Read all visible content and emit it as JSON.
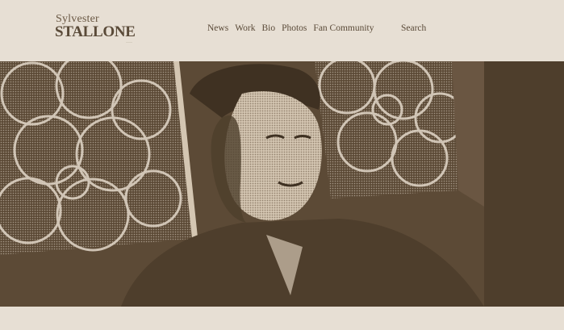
{
  "brand": {
    "first_name": "Sylvester",
    "last_name": "STALLONE",
    "tagline": "........"
  },
  "nav": {
    "items": [
      {
        "label": "News"
      },
      {
        "label": "Work"
      },
      {
        "label": "Bio"
      },
      {
        "label": "Photos"
      },
      {
        "label": "Fan Community"
      }
    ],
    "search_label": "Search"
  },
  "hero": {
    "image": "portrait-photo",
    "tone": "sepia duotone"
  },
  "colors": {
    "background": "#e7dfd4",
    "text": "#5a4a38",
    "hero_dark": "#5c4a36",
    "hero_light": "#e3d8c9"
  }
}
